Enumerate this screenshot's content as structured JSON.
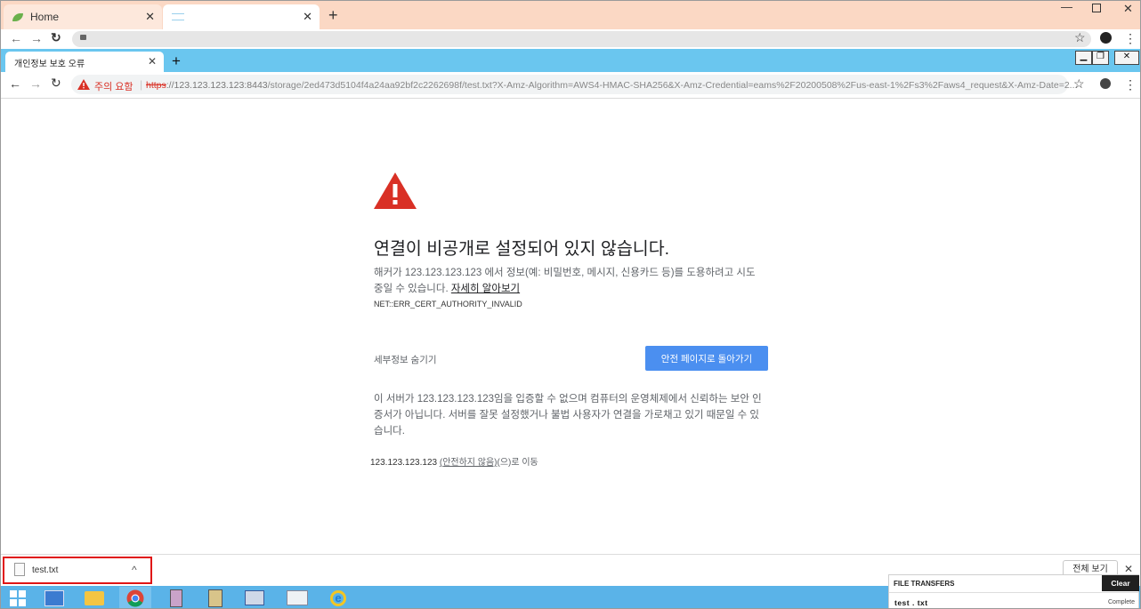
{
  "outer_browser": {
    "tabs": [
      {
        "title": "Home",
        "icon": "leaf-icon"
      },
      {
        "title": "",
        "icon": "page-icon"
      }
    ],
    "new_tab_label": "+"
  },
  "inner_browser": {
    "tab_title": "개인정보 보호 오류",
    "new_tab_label": "+",
    "security_label": "주의 요함",
    "url_scheme": "https",
    "url_host": "://123.123.123.123:8443",
    "url_rest": "/storage/2ed473d5104f4a24aa92bf2c2262698f/test.txt?X-Amz-Algorithm=AWS4-HMAC-SHA256&X-Amz-Credential=eams%2F20200508%2Fus-east-1%2Fs3%2Faws4_request&X-Amz-Date=2..."
  },
  "interstitial": {
    "heading": "연결이 비공개로 설정되어 있지 않습니다.",
    "body_line1": "해커가 123.123.123.123 에서 정보(예: 비밀번호, 메시지, 신용카드 등)를 도용하려고 시도",
    "body_line2_prefix": "중일 수 있습니다. ",
    "learn_more": "자세히 알아보기",
    "error_code": "NET::ERR_CERT_AUTHORITY_INVALID",
    "hide_details": "세부정보 숨기기",
    "back_to_safety": "안전 페이지로 돌아가기",
    "details_text": "이 서버가 123.123.123.123임을 입증할 수 없으며 컴퓨터의 운영체제에서 신뢰하는 보안 인증서가 아닙니다. 서버를 잘못 설정했거나 불법 사용자가 연결을 가로채고 있기 때문일 수 있습니다.",
    "proceed_host": "123.123.123.123",
    "proceed_link": "(안전하지 않음)",
    "proceed_suffix": "(으)로 이동"
  },
  "download_bar": {
    "file_name": "test.txt",
    "show_all": "전체 보기"
  },
  "file_transfers": {
    "title": "FILE TRANSFERS",
    "clear_label": "Clear",
    "file_name": "test . txt",
    "status": "Complete"
  },
  "colors": {
    "outer_tabbar": "#fbd8c4",
    "inner_tabbar": "#6ac6ef",
    "warning_red": "#d93025",
    "primary_button": "#4b8ff0",
    "taskbar": "#5ab3e8",
    "highlight_box": "#e01515"
  }
}
